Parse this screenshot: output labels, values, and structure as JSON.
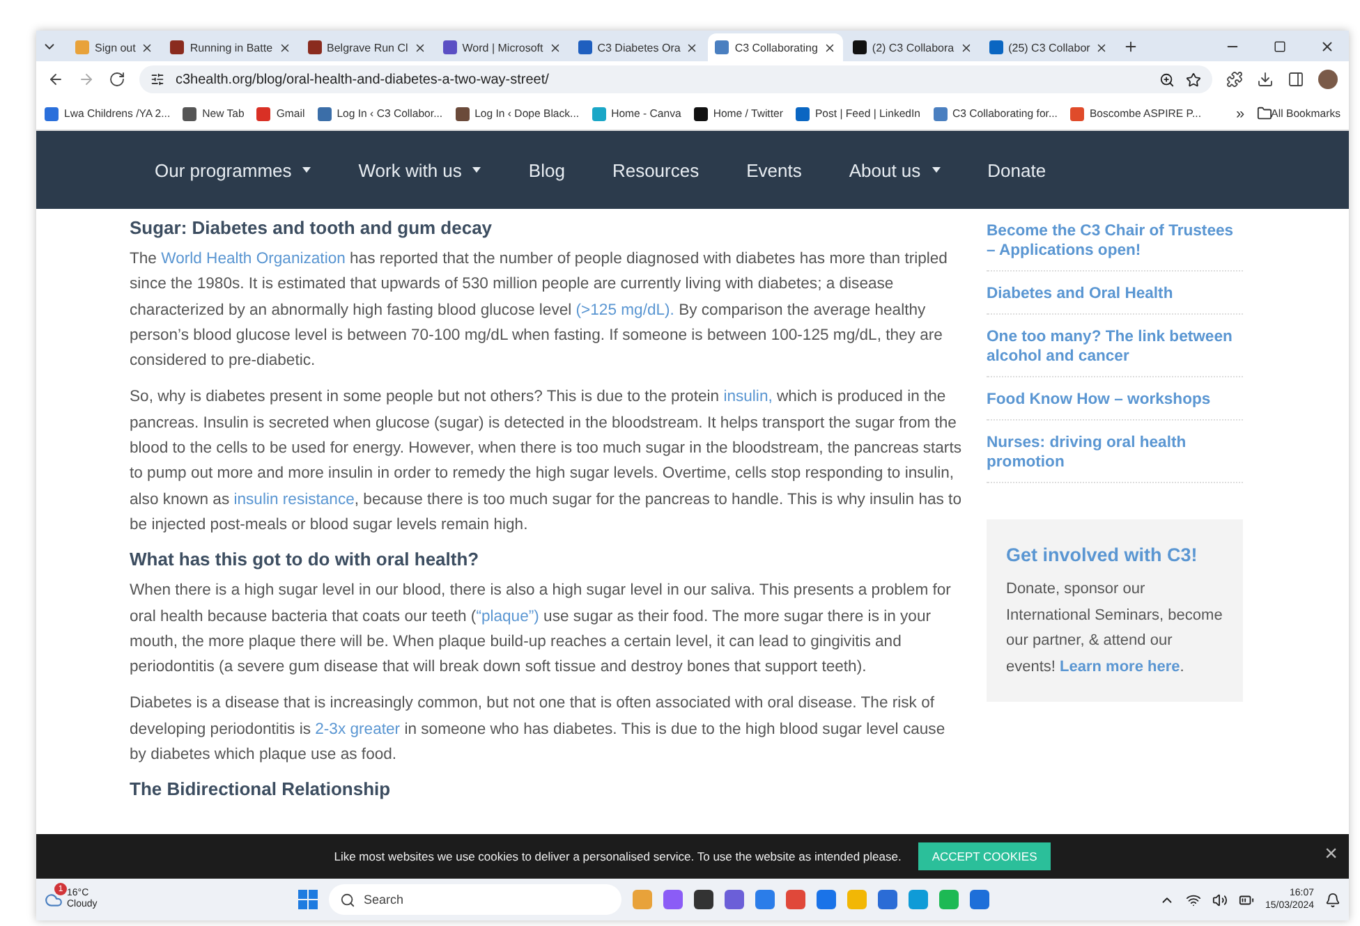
{
  "tabs": [
    {
      "title": "Sign out",
      "selected": false,
      "color": "#e8a23a"
    },
    {
      "title": "Running in Batte",
      "selected": false,
      "color": "#8a2b1e"
    },
    {
      "title": "Belgrave Run Cl",
      "selected": false,
      "color": "#8a2b1e"
    },
    {
      "title": "Word | Microsoft",
      "selected": false,
      "color": "#5b4fc4"
    },
    {
      "title": "C3 Diabetes Ora",
      "selected": false,
      "color": "#1f5fbf"
    },
    {
      "title": "C3 Collaborating",
      "selected": true,
      "color": "#4a7fc0"
    },
    {
      "title": "(2) C3 Collabora",
      "selected": false,
      "color": "#111111"
    },
    {
      "title": "(25) C3 Collabor",
      "selected": false,
      "color": "#0a66c2"
    }
  ],
  "address": "c3health.org/blog/oral-health-and-diabetes-a-two-way-street/",
  "bookmarks": [
    {
      "title": "Lwa Childrens /YA 2...",
      "color": "#2a6fdb"
    },
    {
      "title": "New Tab",
      "color": "#555555"
    },
    {
      "title": "Gmail",
      "color": "#d93025"
    },
    {
      "title": "Log In ‹ C3 Collabor...",
      "color": "#3b6ea8"
    },
    {
      "title": "Log In ‹ Dope Black...",
      "color": "#6b4a3a"
    },
    {
      "title": "Home - Canva",
      "color": "#1aa7c7"
    },
    {
      "title": "Home / Twitter",
      "color": "#111111"
    },
    {
      "title": "Post | Feed | LinkedIn",
      "color": "#0a66c2"
    },
    {
      "title": "C3 Collaborating for...",
      "color": "#4a7fc0"
    },
    {
      "title": "Boscombe ASPIRE P...",
      "color": "#e04b2a"
    }
  ],
  "bookmarks_more": "»",
  "all_bookmarks": "All Bookmarks",
  "nav": [
    {
      "label": "Our programmes",
      "kind": "menu"
    },
    {
      "label": "Work with us",
      "kind": "menu"
    },
    {
      "label": "Blog",
      "kind": "link"
    },
    {
      "label": "Resources",
      "kind": "link"
    },
    {
      "label": "Events",
      "kind": "link"
    },
    {
      "label": "About us",
      "kind": "menu"
    },
    {
      "label": "Donate",
      "kind": "link"
    }
  ],
  "article": [
    {
      "kind": "heading",
      "parts": [
        {
          "text": "Sugar: Diabetes and tooth and gum decay",
          "kind": "text"
        }
      ]
    },
    {
      "kind": "paragraph",
      "parts": [
        {
          "text": "The ",
          "kind": "text"
        },
        {
          "text": "World Health Organization",
          "kind": "link"
        },
        {
          "text": " has reported that the number of people diagnosed with diabetes has more than tripled since the 1980s. It is estimated that upwards of 530 million people are currently living with diabetes; a disease characterized by an abnormally high fasting blood glucose level ",
          "kind": "text"
        },
        {
          "text": "(>125 mg/dL).",
          "kind": "link"
        },
        {
          "text": " By comparison the average healthy person’s blood glucose level is between 70-100 mg/dL when fasting. If someone is between 100-125 mg/dL, they are considered to pre-diabetic.",
          "kind": "text"
        }
      ]
    },
    {
      "kind": "paragraph",
      "parts": [
        {
          "text": "So, why is diabetes present in some people but not others? This is due to the protein ",
          "kind": "text"
        },
        {
          "text": "insulin,",
          "kind": "link"
        },
        {
          "text": " which is produced in the pancreas. Insulin is secreted when glucose (sugar) is detected in the bloodstream. It helps transport the sugar from the blood to the cells to be used for energy. However, when there is too much sugar in the bloodstream, the pancreas starts to pump out more and more insulin in order to remedy the high sugar levels. Overtime, cells stop responding to insulin, also known as ",
          "kind": "text"
        },
        {
          "text": "insulin resistance",
          "kind": "link"
        },
        {
          "text": ", because there is too much sugar for the pancreas to handle. This is why insulin has to be injected post-meals or blood sugar levels remain high.",
          "kind": "text"
        }
      ]
    },
    {
      "kind": "heading",
      "parts": [
        {
          "text": "What has this got to do with oral health?",
          "kind": "text"
        }
      ]
    },
    {
      "kind": "paragraph",
      "parts": [
        {
          "text": "When there is a high sugar level in our blood, there is also a high sugar level in our saliva. This presents a problem for oral health because bacteria that coats our teeth (",
          "kind": "text"
        },
        {
          "text": "“plaque”)",
          "kind": "link"
        },
        {
          "text": " use sugar as their food. The more sugar there is in your mouth, the more plaque there will be. When plaque build-up reaches a certain level, it can lead to gingivitis and periodontitis (a severe gum disease that will break down soft tissue and destroy bones that support teeth).",
          "kind": "text"
        }
      ]
    },
    {
      "kind": "paragraph",
      "parts": [
        {
          "text": "Diabetes is a disease that is increasingly common, but not one that is often associated with oral disease. The risk of developing periodontitis is ",
          "kind": "text"
        },
        {
          "text": "2-3x greater",
          "kind": "link"
        },
        {
          "text": " in someone who has diabetes. This is due to the high blood sugar level cause by diabetes which plaque use as food.",
          "kind": "text"
        }
      ]
    },
    {
      "kind": "heading",
      "parts": [
        {
          "text": "The Bidirectional Relationship",
          "kind": "text"
        }
      ]
    }
  ],
  "recent_posts": [
    "Become the C3 Chair of Trustees – Applications open!",
    "Diabetes and Oral Health",
    "One too many? The link between alcohol and cancer",
    "Food Know How – workshops",
    "Nurses: driving oral health promotion"
  ],
  "get_involved": {
    "title": "Get involved with C3!",
    "text": "Donate, sponsor our International Seminars, become our partner, & attend our events! ",
    "link": "Learn more here",
    "end": "."
  },
  "cookie": {
    "message": "Like most websites we use cookies to deliver a personalised service. To use the website as intended please.",
    "button": "ACCEPT COOKIES",
    "close": "×"
  },
  "taskbar": {
    "temperature": "16°C",
    "weather": "Cloudy",
    "badge": "1",
    "search": "Search",
    "time": "16:07",
    "date": "15/03/2024"
  }
}
